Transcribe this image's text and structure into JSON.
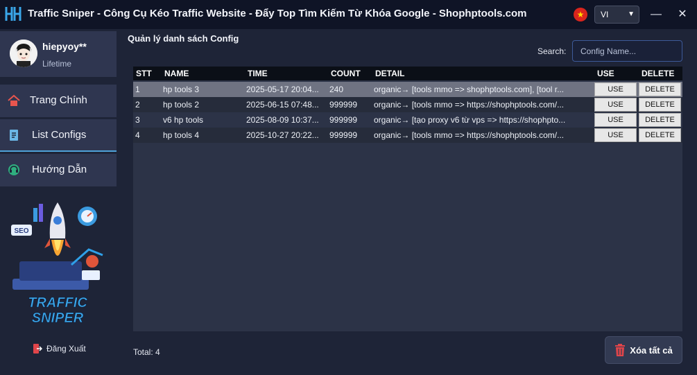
{
  "window": {
    "title": "Traffic Sniper - Công Cụ Kéo Traffic Website - Đẩy Top Tìm Kiếm Từ Khóa Google - Shophptools.com",
    "language": "VI",
    "minimize_glyph": "—",
    "close_glyph": "✕"
  },
  "user": {
    "name": "hiepyoy**",
    "plan": "Lifetime"
  },
  "nav": [
    {
      "label": "Trang Chính",
      "icon": "home-icon"
    },
    {
      "label": "List Configs",
      "icon": "document-icon",
      "active": true
    },
    {
      "label": "Hướng Dẫn",
      "icon": "headset-icon"
    }
  ],
  "promo": {
    "line1": "TRAFFIC",
    "line2": "SNIPER",
    "badge": "SEO"
  },
  "logout": {
    "label": "Đăng Xuất"
  },
  "panel": {
    "title": "Quản lý danh sách Config"
  },
  "search": {
    "label": "Search:",
    "placeholder": "Config Name..."
  },
  "table": {
    "headers": {
      "stt": "STT",
      "name": "NAME",
      "time": "TIME",
      "count": "COUNT",
      "detail": "DETAIL",
      "use": "USE",
      "delete": "DELETE"
    },
    "use_label": "USE",
    "delete_label": "DELETE",
    "rows": [
      {
        "stt": "1",
        "name": "hp tools 3",
        "time": "2025-05-17 20:04...",
        "count": "240",
        "detail": "organic→ [tools mmo => shophptools.com], [tool r..."
      },
      {
        "stt": "2",
        "name": "hp tools 2",
        "time": "2025-06-15 07:48...",
        "count": "999999",
        "detail": "organic→ [tools mmo => https://shophptools.com/..."
      },
      {
        "stt": "3",
        "name": "v6 hp tools",
        "time": "2025-08-09 10:37...",
        "count": "999999",
        "detail": "organic→ [tạo proxy v6 từ vps => https://shophpto..."
      },
      {
        "stt": "4",
        "name": "hp tools 4",
        "time": "2025-10-27 20:22...",
        "count": "999999",
        "detail": "organic→ [tools mmo => https://shophptools.com/..."
      }
    ]
  },
  "footer": {
    "total_label": "Total:",
    "total_value": "4",
    "clear_all_label": "Xóa tất cả"
  },
  "colors": {
    "accent": "#4fa3d9",
    "danger": "#e0454a",
    "selected_row": "#6f7382"
  }
}
